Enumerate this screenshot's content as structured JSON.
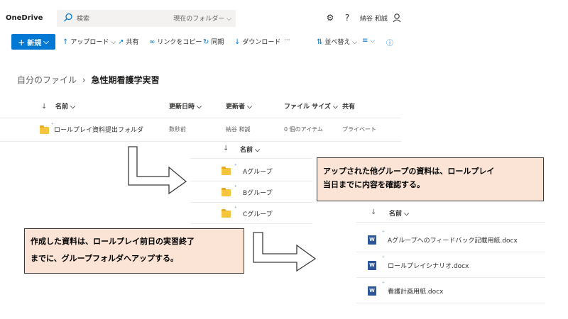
{
  "app": {
    "title": "OneDrive"
  },
  "search": {
    "placeholder": "検索",
    "scope": "現在のフォルダー"
  },
  "user": {
    "name": "納谷 和誠"
  },
  "toolbar": {
    "new_label": "新規",
    "upload_label": "アップロード",
    "share_label": "共有",
    "copy_link_label": "リンクをコピー",
    "sync_label": "同期",
    "download_label": "ダウンロード",
    "more_label": "···",
    "sort_label": "並べ替え"
  },
  "breadcrumb": {
    "root": "自分のファイル",
    "separator": "›",
    "current": "急性期看護学実習"
  },
  "list": {
    "columns": {
      "name": "名前",
      "modified": "更新日時",
      "modified_by": "更新者",
      "size": "ファイル サイズ",
      "sharing": "共有"
    },
    "rows": [
      {
        "name": "ロールプレイ資料提出フォルダ",
        "modified": "数秒前",
        "modified_by": "納谷 和誠",
        "size": "0 個のアイテム",
        "sharing": "プライベート"
      }
    ]
  },
  "subfolder_list": {
    "header": "名前",
    "items": [
      "Aグループ",
      "Bグループ",
      "Cグループ"
    ]
  },
  "document_list": {
    "header": "名前",
    "items": [
      "Aグループへのフィードバック記載用紙.docx",
      "ロールプレイシナリオ.docx",
      "看護計画用紙.docx"
    ]
  },
  "callouts": {
    "top": {
      "line1": "アップされた他グループの資料は、ロールプレイ",
      "line2": "当日までに内容を確認する。"
    },
    "bottom": {
      "line1": "作成した資料は、ロールプレイ前日の実習終了",
      "line2": "までに、グループフォルダへアップする。"
    }
  },
  "colors": {
    "accent": "#0078d4",
    "folder": "#f4c43d",
    "callout_bg": "#fbe4d6",
    "word": "#2b579a"
  }
}
